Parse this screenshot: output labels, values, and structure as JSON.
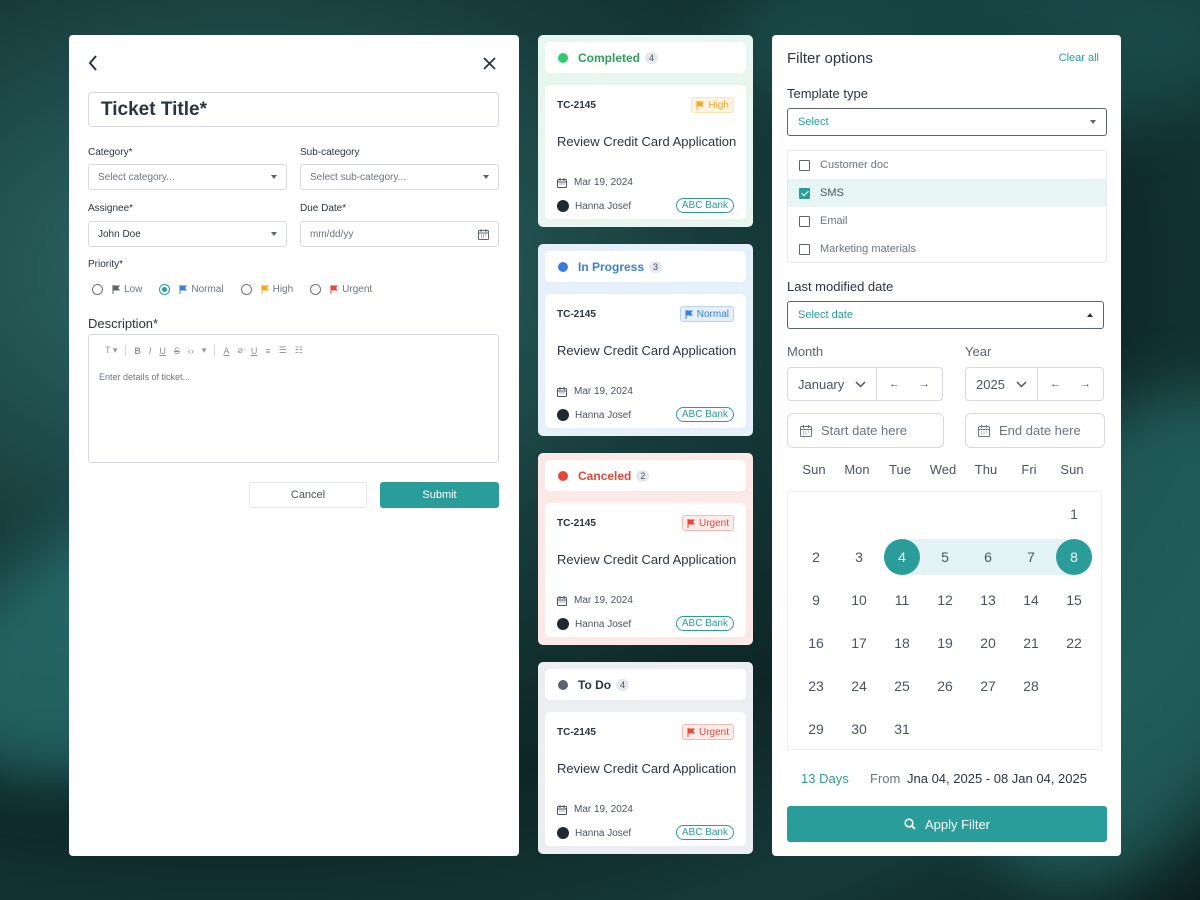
{
  "form": {
    "title_placeholder": "Ticket Title*",
    "category_label": "Category*",
    "category_placeholder": "Select category...",
    "subcategory_label": "Sub-category",
    "subcategory_placeholder": "Select sub-category...",
    "assignee_label": "Assignee*",
    "assignee_value": "John Doe",
    "due_date_label": "Due Date*",
    "due_date_placeholder": "mm/dd/yy",
    "priority_label": "Priority*",
    "priorities": [
      {
        "label": "Low",
        "color": "#5b6470",
        "checked": false
      },
      {
        "label": "Normal",
        "color": "#3b7ddd",
        "checked": true
      },
      {
        "label": "High",
        "color": "#f5a623",
        "checked": false
      },
      {
        "label": "Urgent",
        "color": "#e5483b",
        "checked": false
      }
    ],
    "description_label": "Description*",
    "description_placeholder": "Enter details of ticket...",
    "toolbar_text_style": "T",
    "cancel_label": "Cancel",
    "submit_label": "Submit",
    "accent": "#2a9d9a"
  },
  "columns": [
    {
      "status": "Completed",
      "count": "4",
      "dot": "#2ecc71",
      "text_color": "#2e9e5b",
      "bg": "#e7f6ee",
      "card": {
        "id": "TC-2145",
        "priority": "High",
        "prio_color": "#f5a623",
        "prio_bg": "#fff4e0",
        "prio_border": "#fde3b4",
        "title": "Review Credit Card Application",
        "date": "Mar 19, 2024",
        "user": "Hanna Josef",
        "bank": "ABC Bank"
      }
    },
    {
      "status": "In Progress",
      "count": "3",
      "dot": "#3b7ddd",
      "text_color": "#3b7ddd",
      "bg": "#e6f0fb",
      "card": {
        "id": "TC-2145",
        "priority": "Normal",
        "prio_color": "#3b7ddd",
        "prio_bg": "#e6f0fb",
        "prio_border": "#b9d2f3",
        "title": "Review Credit Card Application",
        "date": "Mar 19, 2024",
        "user": "Hanna Josef",
        "bank": "ABC Bank"
      }
    },
    {
      "status": "Canceled",
      "count": "2",
      "dot": "#e5483b",
      "text_color": "#e5483b",
      "bg": "#fbe9e7",
      "card": {
        "id": "TC-2145",
        "priority": "Urgent",
        "prio_color": "#e5483b",
        "prio_bg": "#fdecea",
        "prio_border": "#f6b9b3",
        "title": "Review Credit Card Application",
        "date": "Mar 19, 2024",
        "user": "Hanna Josef",
        "bank": "ABC Bank"
      }
    },
    {
      "status": "To Do",
      "count": "4",
      "dot": "#5b6470",
      "text_color": "#2a3441",
      "bg": "#eceef1",
      "card": {
        "id": "TC-2145",
        "priority": "Urgent",
        "prio_color": "#e5483b",
        "prio_bg": "#fdecea",
        "prio_border": "#f6b9b3",
        "title": "Review Credit Card Application",
        "date": "Mar 19, 2024",
        "user": "Hanna Josef",
        "bank": "ABC Bank"
      }
    }
  ],
  "filter": {
    "title": "Filter options",
    "clear_all": "Clear all",
    "template_type_label": "Template type",
    "template_select_placeholder": "Select",
    "template_options": [
      {
        "label": "Customer doc",
        "checked": false
      },
      {
        "label": "SMS",
        "checked": true
      },
      {
        "label": "Email",
        "checked": false
      },
      {
        "label": "Marketing materials",
        "checked": false
      }
    ],
    "last_modified_label": "Last modified date",
    "date_select_placeholder": "Select date",
    "month_label": "Month",
    "month_value": "January",
    "year_label": "Year",
    "year_value": "2025",
    "start_date_placeholder": "Start date here",
    "end_date_placeholder": "End date here",
    "weekdays": [
      "Sun",
      "Mon",
      "Tue",
      "Wed",
      "Thu",
      "Fri",
      "Sun"
    ],
    "calendar_rows": [
      [
        "",
        "",
        "",
        "",
        "",
        "",
        "1"
      ],
      [
        "2",
        "3",
        "4",
        "5",
        "6",
        "7",
        "8"
      ],
      [
        "9",
        "10",
        "11",
        "12",
        "13",
        "14",
        "15"
      ],
      [
        "16",
        "17",
        "18",
        "19",
        "20",
        "21",
        "22"
      ],
      [
        "23",
        "24",
        "25",
        "26",
        "27",
        "28",
        ""
      ],
      [
        "29",
        "30",
        "31",
        "",
        "",
        "",
        ""
      ]
    ],
    "range_start": "4",
    "range_end": "8",
    "days_count": "13 Days",
    "from_label": "From",
    "range_text": "Jna 04, 2025 - 08 Jan 04, 2025",
    "apply_label": "Apply Filter",
    "accent": "#2a9d9a"
  }
}
